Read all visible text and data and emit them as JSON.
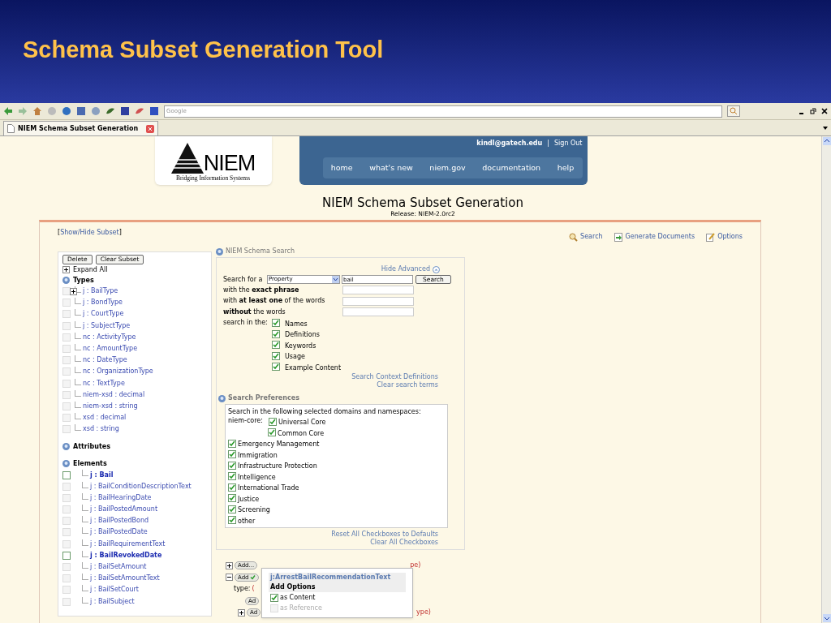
{
  "slide": {
    "title": "Schema Subset Generation Tool"
  },
  "browser": {
    "search_placeholder": "Google",
    "tab": "NIEM Schema Subset Generation"
  },
  "page": {
    "logo": {
      "word": "NIEM",
      "tagline": "Bridging Information Systems"
    },
    "user": "kindl@gatech.edu",
    "separator": "|",
    "sign_out": "Sign Out",
    "nav": [
      "home",
      "what's new",
      "niem.gov",
      "documentation",
      "help"
    ],
    "heading": "NIEM Schema Subset Generation",
    "release": "Release: NIEM-2.0rc2",
    "show_hide": {
      "open": "[",
      "link": "Show/Hide Subset",
      "close": "]"
    },
    "actions": [
      {
        "kind": "search",
        "label": "Search"
      },
      {
        "kind": "generate",
        "label": "Generate Documents"
      },
      {
        "kind": "options",
        "label": "Options"
      }
    ]
  },
  "subset": {
    "buttons": [
      "Delete",
      "Clear Subset"
    ],
    "expand_all": "Expand All",
    "sections": [
      {
        "title": "Types",
        "items": [
          {
            "label": "j : BailType",
            "expandable": true,
            "highlighted": false
          },
          {
            "label": "j : BondType",
            "expandable": false,
            "highlighted": false
          },
          {
            "label": "j : CourtType",
            "expandable": false,
            "highlighted": false
          },
          {
            "label": "j : SubjectType",
            "expandable": false,
            "highlighted": false
          },
          {
            "label": "nc : ActivityType",
            "expandable": false,
            "highlighted": false
          },
          {
            "label": "nc : AmountType",
            "expandable": false,
            "highlighted": false
          },
          {
            "label": "nc : DateType",
            "expandable": false,
            "highlighted": false
          },
          {
            "label": "nc : OrganizationType",
            "expandable": false,
            "highlighted": false
          },
          {
            "label": "nc : TextType",
            "expandable": false,
            "highlighted": false
          },
          {
            "label": "niem-xsd : decimal",
            "expandable": false,
            "highlighted": false
          },
          {
            "label": "niem-xsd : string",
            "expandable": false,
            "highlighted": false
          },
          {
            "label": "xsd : decimal",
            "expandable": false,
            "highlighted": false
          },
          {
            "label": "xsd : string",
            "expandable": false,
            "highlighted": false
          }
        ]
      },
      {
        "title": "Attributes"
      },
      {
        "title": "Elements",
        "items": [
          {
            "label": "j : Bail",
            "expandable": false,
            "highlighted": true
          },
          {
            "label": "j : BailConditionDescriptionText",
            "expandable": false,
            "highlighted": false
          },
          {
            "label": "j : BailHearingDate",
            "expandable": false,
            "highlighted": false
          },
          {
            "label": "j : BailPostedAmount",
            "expandable": false,
            "highlighted": false
          },
          {
            "label": "j : BailPostedBond",
            "expandable": false,
            "highlighted": false
          },
          {
            "label": "j : BailPostedDate",
            "expandable": false,
            "highlighted": false
          },
          {
            "label": "j : BailRequirementText",
            "expandable": false,
            "highlighted": false
          },
          {
            "label": "j : BailRevokedDate",
            "expandable": false,
            "highlighted": true
          },
          {
            "label": "j : BailSetAmount",
            "expandable": false,
            "highlighted": false
          },
          {
            "label": "j : BailSetAmountText",
            "expandable": false,
            "highlighted": false
          },
          {
            "label": "j : BailSetCourt",
            "expandable": false,
            "highlighted": false
          },
          {
            "label": "j : BailSubject",
            "expandable": false,
            "highlighted": false
          }
        ]
      }
    ]
  },
  "search": {
    "title": "NIEM Schema Search",
    "hide_advanced": "Hide Advanced",
    "search_for": "Search for a",
    "type_select": "Property",
    "query": "bail",
    "button": "Search",
    "advanced": [
      "with the **exact phrase**",
      "with **at least one** of the words",
      "**without** the words"
    ],
    "search_in": "search in the:",
    "fields": [
      {
        "label": "Names",
        "checked": true
      },
      {
        "label": "Definitions",
        "checked": true
      },
      {
        "label": "Keywords",
        "checked": true
      },
      {
        "label": "Usage",
        "checked": true
      },
      {
        "label": "Example Content",
        "checked": true
      }
    ],
    "links": [
      "Search Context Definitions",
      "Clear search terms"
    ]
  },
  "preferences": {
    "title": "Search Preferences",
    "intro": "Search in the following selected domains and namespaces:",
    "core_label": "niem-core:",
    "core": [
      {
        "label": "Universal Core",
        "checked": true
      },
      {
        "label": "Common Core",
        "checked": true
      }
    ],
    "domains": [
      {
        "label": "Emergency Management",
        "checked": true
      },
      {
        "label": "Immigration",
        "checked": true
      },
      {
        "label": "Infrastructure Protection",
        "checked": true
      },
      {
        "label": "Intelligence",
        "checked": true
      },
      {
        "label": "International Trade",
        "checked": true
      },
      {
        "label": "Justice",
        "checked": true
      },
      {
        "label": "Screening",
        "checked": true
      },
      {
        "label": "other",
        "checked": true
      }
    ],
    "links": [
      "Reset All Checkboxes to Defaults",
      "Clear All Checkboxes"
    ]
  },
  "results": [
    {
      "kind": "entry",
      "expanded": false,
      "button": "Add...",
      "tail": "pe)",
      "added": false
    },
    {
      "kind": "entry",
      "expanded": true,
      "button": "Add",
      "added": true
    },
    {
      "kind": "type",
      "text": "type:",
      "paren": "("
    },
    {
      "kind": "child",
      "button": "Ad"
    },
    {
      "kind": "entry",
      "expanded": false,
      "button": "Ad",
      "tail": "ype)",
      "added": false
    }
  ],
  "popup": {
    "title": "j:ArrestBailRecommendationText",
    "heading": "Add Options",
    "options": [
      {
        "label": "as Content",
        "checked": true,
        "disabled": false
      },
      {
        "label": "as Reference",
        "checked": false,
        "disabled": true
      }
    ]
  }
}
